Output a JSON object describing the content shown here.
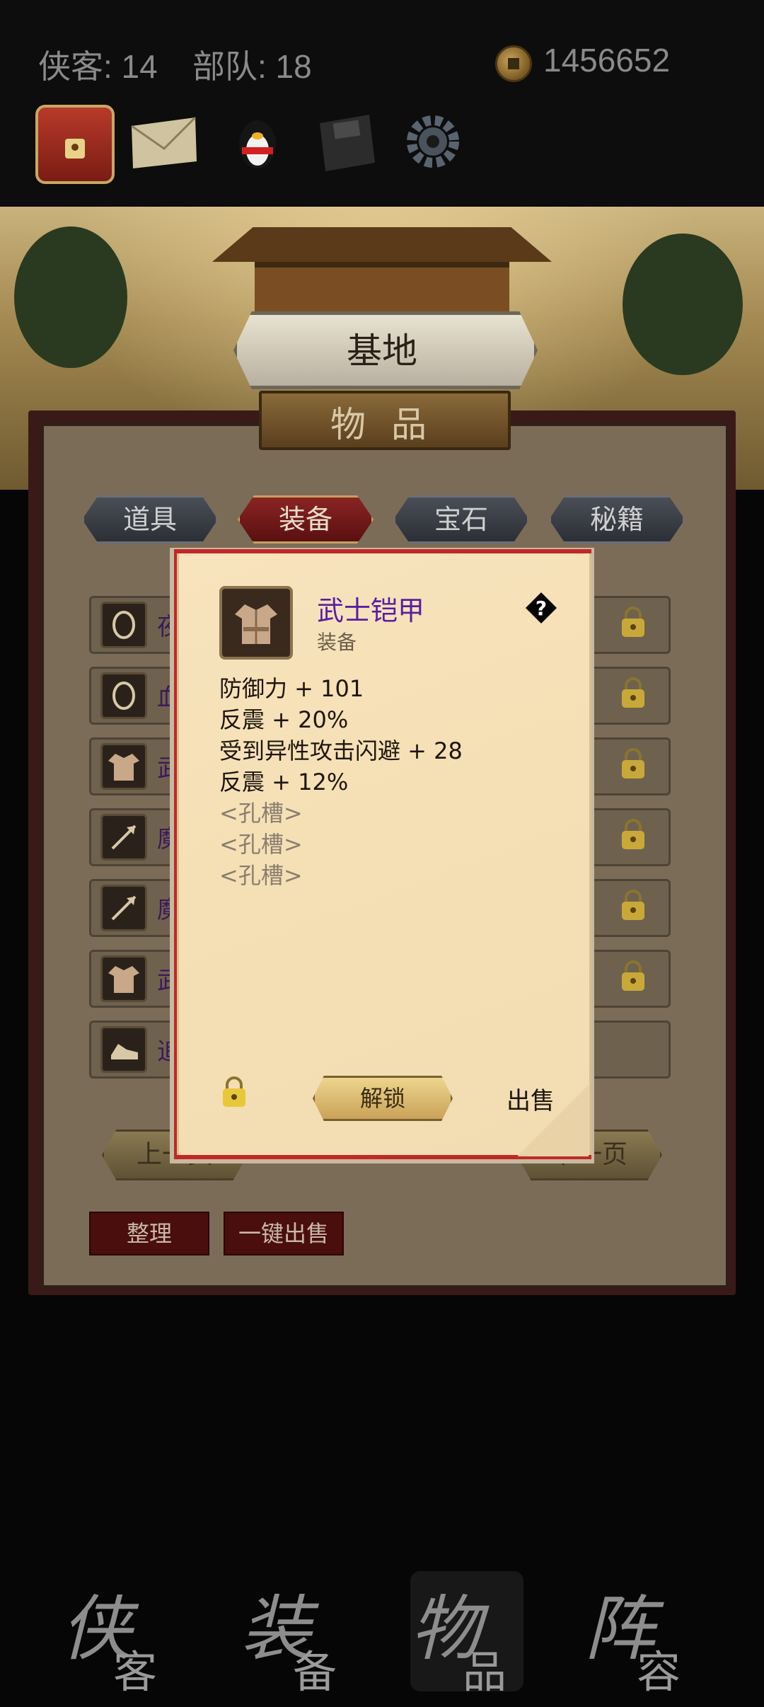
{
  "header": {
    "heroes_label": "侠客: 14",
    "troops_label": "部队: 18",
    "coins": "1456652",
    "icons": [
      "treasure-chest-icon",
      "mail-icon",
      "qq-penguin-icon",
      "save-disk-icon",
      "settings-gear-icon"
    ]
  },
  "scene": {
    "base_label": "基地",
    "items_title": "物 品"
  },
  "tabs": [
    {
      "label": "道具"
    },
    {
      "label": "装备",
      "active": true
    },
    {
      "label": "宝石"
    },
    {
      "label": "秘籍"
    }
  ],
  "list": {
    "rows": [
      {
        "icon": "ring-icon",
        "name_fragment": "夜",
        "locked": true
      },
      {
        "icon": "ring-icon",
        "name_fragment": "血",
        "locked": true
      },
      {
        "icon": "armor-icon",
        "name_fragment": "武",
        "locked": true
      },
      {
        "icon": "arrow-icon",
        "name_fragment": "魔",
        "locked": true
      },
      {
        "icon": "arrow-icon",
        "name_fragment": "魔",
        "locked": true
      },
      {
        "icon": "armor-icon",
        "name_fragment": "武",
        "locked": true
      },
      {
        "icon": "boot-icon",
        "name_fragment": "追",
        "locked": false
      }
    ],
    "prev_label": "上一页",
    "next_label": "下一页",
    "sort_label": "整理",
    "sell_all_label": "一键出售"
  },
  "modal": {
    "name": "武士铠甲",
    "type": "装备",
    "attributes": [
      "防御力 + 101",
      "反震 + 20%",
      "受到异性攻击闪避 + 28",
      "反震 + 12%"
    ],
    "sockets": [
      "<孔槽>",
      "<孔槽>",
      "<孔槽>"
    ],
    "unlock_label": "解锁",
    "sell_label": "出售",
    "colors": {
      "name": "#5a1ea0",
      "border": "#c02828"
    }
  },
  "bottom_nav": [
    {
      "big": "侠",
      "small": "客"
    },
    {
      "big": "装",
      "small": "备"
    },
    {
      "big": "物",
      "small": "品",
      "active": true
    },
    {
      "big": "阵",
      "small": "容"
    }
  ]
}
